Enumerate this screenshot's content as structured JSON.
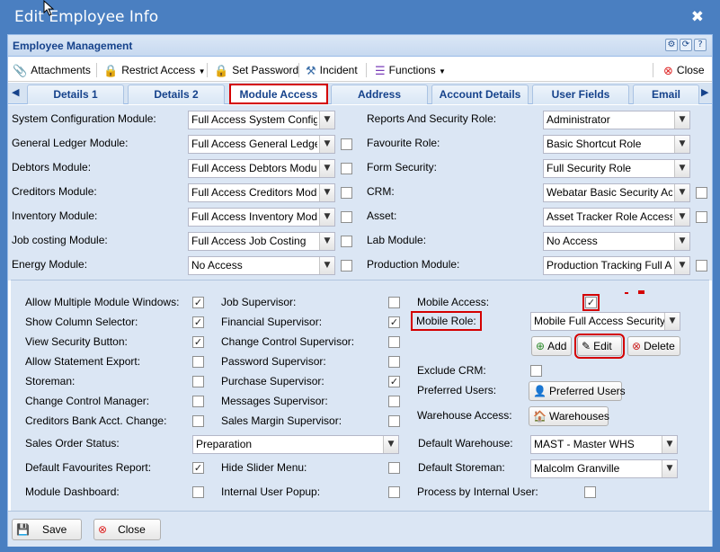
{
  "window": {
    "title": "Edit Employee Info",
    "close_glyph": "✖"
  },
  "panel": {
    "title": "Employee Management",
    "header_icons": [
      "⚙",
      "⟳",
      "?"
    ]
  },
  "toolbar": {
    "attachments": "Attachments",
    "restrict_access": "Restrict Access",
    "set_password": "Set Password",
    "incident": "Incident",
    "functions": "Functions",
    "close": "Close"
  },
  "tabs": [
    "Details 1",
    "Details 2",
    "Module Access",
    "Address",
    "Account Details",
    "User Fields",
    "Email"
  ],
  "active_tab": "Module Access",
  "modules_left": [
    {
      "label": "System Configuration Module:",
      "value": "Full Access System Config",
      "checkbox": false
    },
    {
      "label": "General Ledger Module:",
      "value": "Full Access General Ledger",
      "checkbox": true
    },
    {
      "label": "Debtors Module:",
      "value": "Full Access Debtors Module",
      "checkbox": true
    },
    {
      "label": "Creditors Module:",
      "value": "Full Access Creditors Module",
      "checkbox": true
    },
    {
      "label": "Inventory Module:",
      "value": "Full Access Inventory Module",
      "checkbox": true
    },
    {
      "label": "Job costing Module:",
      "value": "Full Access Job Costing",
      "checkbox": true
    },
    {
      "label": "Energy Module:",
      "value": "No Access",
      "checkbox": true
    }
  ],
  "modules_right": [
    {
      "label": "Reports And Security Role:",
      "value": "Administrator",
      "checkbox": false
    },
    {
      "label": "Favourite Role:",
      "value": "Basic Shortcut Role",
      "checkbox": false
    },
    {
      "label": "Form Security:",
      "value": "Full Security Role",
      "checkbox": false
    },
    {
      "label": "CRM:",
      "value": "Webatar Basic Security Access",
      "checkbox": true
    },
    {
      "label": "Asset:",
      "value": "Asset Tracker Role Access",
      "checkbox": true
    },
    {
      "label": "Lab Module:",
      "value": "No Access",
      "checkbox": false
    },
    {
      "label": "Production Module:",
      "value": "Production Tracking Full Access",
      "checkbox": true
    }
  ],
  "opts_col1": [
    {
      "label": "Allow Multiple Module Windows:",
      "checked": true
    },
    {
      "label": "Show Column Selector:",
      "checked": true
    },
    {
      "label": "View Security Button:",
      "checked": true
    },
    {
      "label": "Allow Statement Export:",
      "checked": false
    },
    {
      "label": "Storeman:",
      "checked": false
    },
    {
      "label": "Change Control Manager:",
      "checked": false
    },
    {
      "label": "Creditors Bank Acct. Change:",
      "checked": false
    }
  ],
  "opts_col2": [
    {
      "label": "Job Supervisor:",
      "checked": false
    },
    {
      "label": "Financial Supervisor:",
      "checked": true
    },
    {
      "label": "Change Control Supervisor:",
      "checked": false
    },
    {
      "label": "Password Supervisor:",
      "checked": false
    },
    {
      "label": "Purchase Supervisor:",
      "checked": true
    },
    {
      "label": "Messages Supervisor:",
      "checked": false
    },
    {
      "label": "Sales Margin Supervisor:",
      "checked": false
    }
  ],
  "mobile": {
    "access_label": "Mobile Access:",
    "access_checked": true,
    "role_label": "Mobile Role:",
    "role_value": "Mobile Full Access Security",
    "add": "Add",
    "edit": "Edit",
    "delete": "Delete",
    "exclude_crm_label": "Exclude CRM:",
    "exclude_crm_checked": false,
    "preferred_users_label": "Preferred Users:",
    "preferred_users_button": "Preferred Users",
    "warehouse_access_label": "Warehouse Access:",
    "warehouses_button": "Warehouses"
  },
  "sales_order_status": {
    "label": "Sales Order Status:",
    "value": "Preparation"
  },
  "default_warehouse": {
    "label": "Default Warehouse:",
    "value": "MAST - Master WHS"
  },
  "default_storeman": {
    "label": "Default Storeman:",
    "value": "Malcolm Granville"
  },
  "bottom_opts": [
    {
      "label": "Default Favourites Report:",
      "checked": true
    },
    {
      "label": "Hide Slider Menu:",
      "checked": false
    },
    {
      "label": "Module Dashboard:",
      "checked": false
    },
    {
      "label": "Internal User Popup:",
      "checked": false
    },
    {
      "label": "Process by Internal User:",
      "checked": false
    }
  ],
  "footer": {
    "save": "Save",
    "close": "Close"
  }
}
